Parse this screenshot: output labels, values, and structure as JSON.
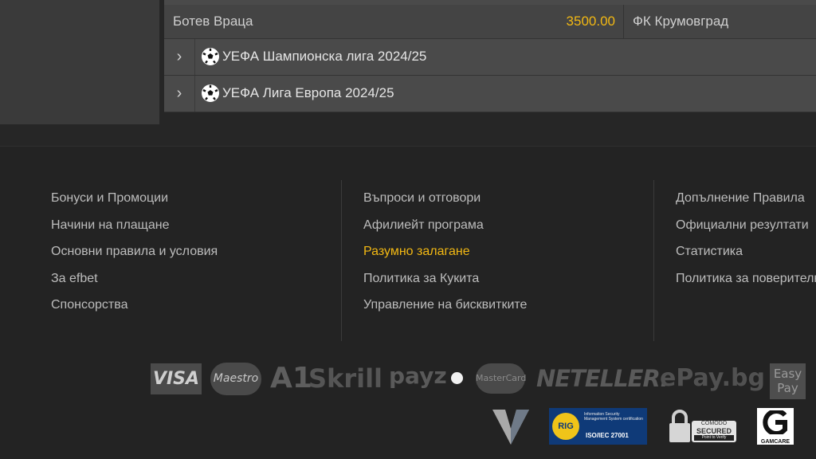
{
  "results_table": {
    "home_team": "Ботев Враца",
    "odds": "3500.00",
    "away_team": "ФК Крумовград"
  },
  "competitions": [
    {
      "label": "УЕФА Шампионска лига 2024/25",
      "icon": "soccer-ball-icon"
    },
    {
      "label": "УЕФА Лига Европа 2024/25",
      "icon": "soccer-ball-icon"
    }
  ],
  "footer": {
    "col1": [
      "Бонуси и Промоции",
      "Начини на плащане",
      "Основни правила и условия",
      "За efbet",
      "Спонсорства"
    ],
    "col2": [
      "Въпроси и отговори",
      "Афилиейт програма",
      "Разумно залагане",
      "Политика за Кукита",
      "Управление на бисквитките"
    ],
    "col3": [
      "Допълнение Правила",
      "Официални резултати",
      "Статистика",
      "Политика за поверителност"
    ],
    "highlight_color": "#f2b813"
  },
  "payment_logos": {
    "visa": "VISA",
    "maestro": "Maestro",
    "a1": "A1",
    "skrill": "Skrill",
    "payz": "payz",
    "mastercard": "MasterCard",
    "neteller": "NETELLER.",
    "epay": "ePay.bg",
    "easypay_1": "Easy",
    "easypay_2": "Pay"
  },
  "cert_logos": {
    "rig": "RIG",
    "iso_title": "Information Security Management System certification",
    "iso_code": "ISO/IEC 27001",
    "comodo_1": "COMODO",
    "comodo_2": "SECURED",
    "comodo_3": "Point to Verify",
    "gamcare": "GAMCARE"
  }
}
